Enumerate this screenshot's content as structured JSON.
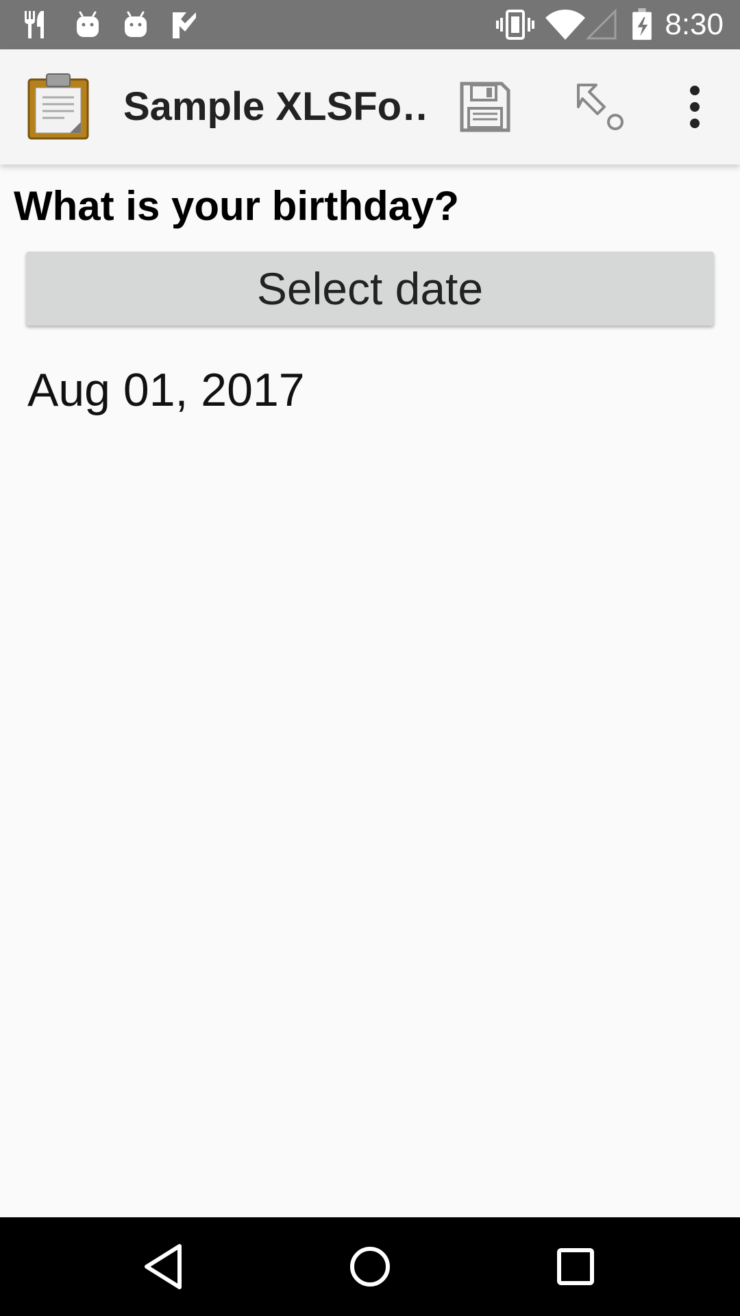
{
  "status_bar": {
    "time": "8:30",
    "icons_left": [
      "restaurant-icon",
      "android-icon",
      "android-icon",
      "check-icon"
    ],
    "icons_right": [
      "vibrate-icon",
      "wifi-icon",
      "cell-signal-icon",
      "battery-charging-icon"
    ]
  },
  "app_bar": {
    "title": "Sample XLSFo…",
    "logo_icon": "clipboard-icon",
    "actions": [
      {
        "name": "save-icon"
      },
      {
        "name": "go-to-icon"
      },
      {
        "name": "more-options-icon"
      }
    ]
  },
  "form": {
    "question": "What is your birthday?",
    "select_button_label": "Select date",
    "answer_value": "Aug 01, 2017"
  },
  "nav_bar": {
    "buttons": [
      "back-icon",
      "home-icon",
      "recents-icon"
    ]
  },
  "colors": {
    "status_bar": "#757575",
    "app_bar": "#f5f5f5",
    "background": "#fafafa",
    "button": "#d6d7d7",
    "nav_bar": "#000000"
  }
}
